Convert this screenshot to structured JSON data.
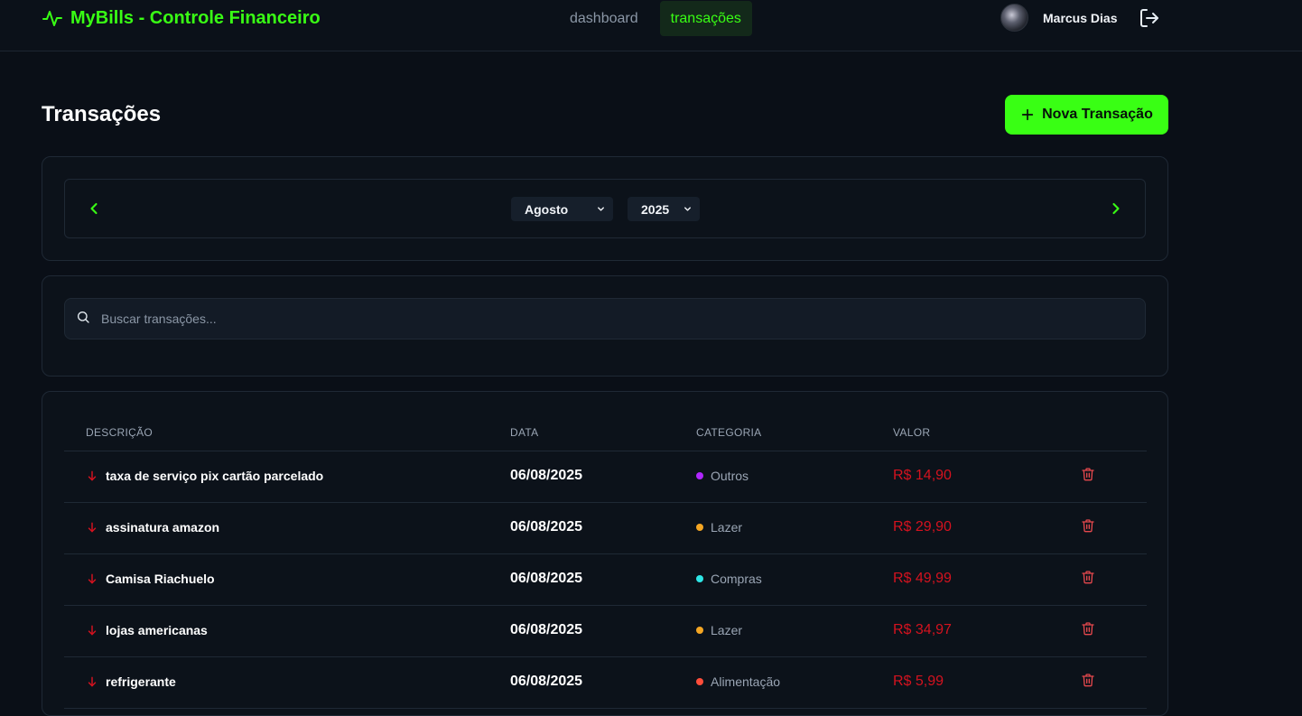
{
  "app": {
    "title": "MyBills - Controle Financeiro"
  },
  "nav": {
    "items": [
      {
        "label": "dashboard"
      },
      {
        "label": "transações"
      }
    ]
  },
  "user": {
    "name": "Marcus Dias"
  },
  "page": {
    "title": "Transações",
    "new_button": "Nova Transação"
  },
  "period": {
    "month": "Agosto",
    "year": "2025"
  },
  "search": {
    "placeholder": "Buscar transações..."
  },
  "table": {
    "headers": {
      "description": "DESCRIÇÃO",
      "date": "DATA",
      "category": "CATEGORIA",
      "value": "VALOR"
    },
    "rows": [
      {
        "description": "taxa de serviço pix cartão parcelado",
        "date": "06/08/2025",
        "category": "Outros",
        "category_color": "#b026ff",
        "value": "R$ 14,90"
      },
      {
        "description": "assinatura amazon",
        "date": "06/08/2025",
        "category": "Lazer",
        "category_color": "#f5a623",
        "value": "R$ 29,90"
      },
      {
        "description": "Camisa Riachuelo",
        "date": "06/08/2025",
        "category": "Compras",
        "category_color": "#2ee6e6",
        "value": "R$ 49,99"
      },
      {
        "description": "lojas americanas",
        "date": "06/08/2025",
        "category": "Lazer",
        "category_color": "#f5a623",
        "value": "R$ 34,97"
      },
      {
        "description": "refrigerante",
        "date": "06/08/2025",
        "category": "Alimentação",
        "category_color": "#ff4d3a",
        "value": "R$ 5,99"
      }
    ]
  },
  "colors": {
    "accent": "#39ff14",
    "expense": "#d4121f",
    "delete_icon": "#e5484d"
  }
}
